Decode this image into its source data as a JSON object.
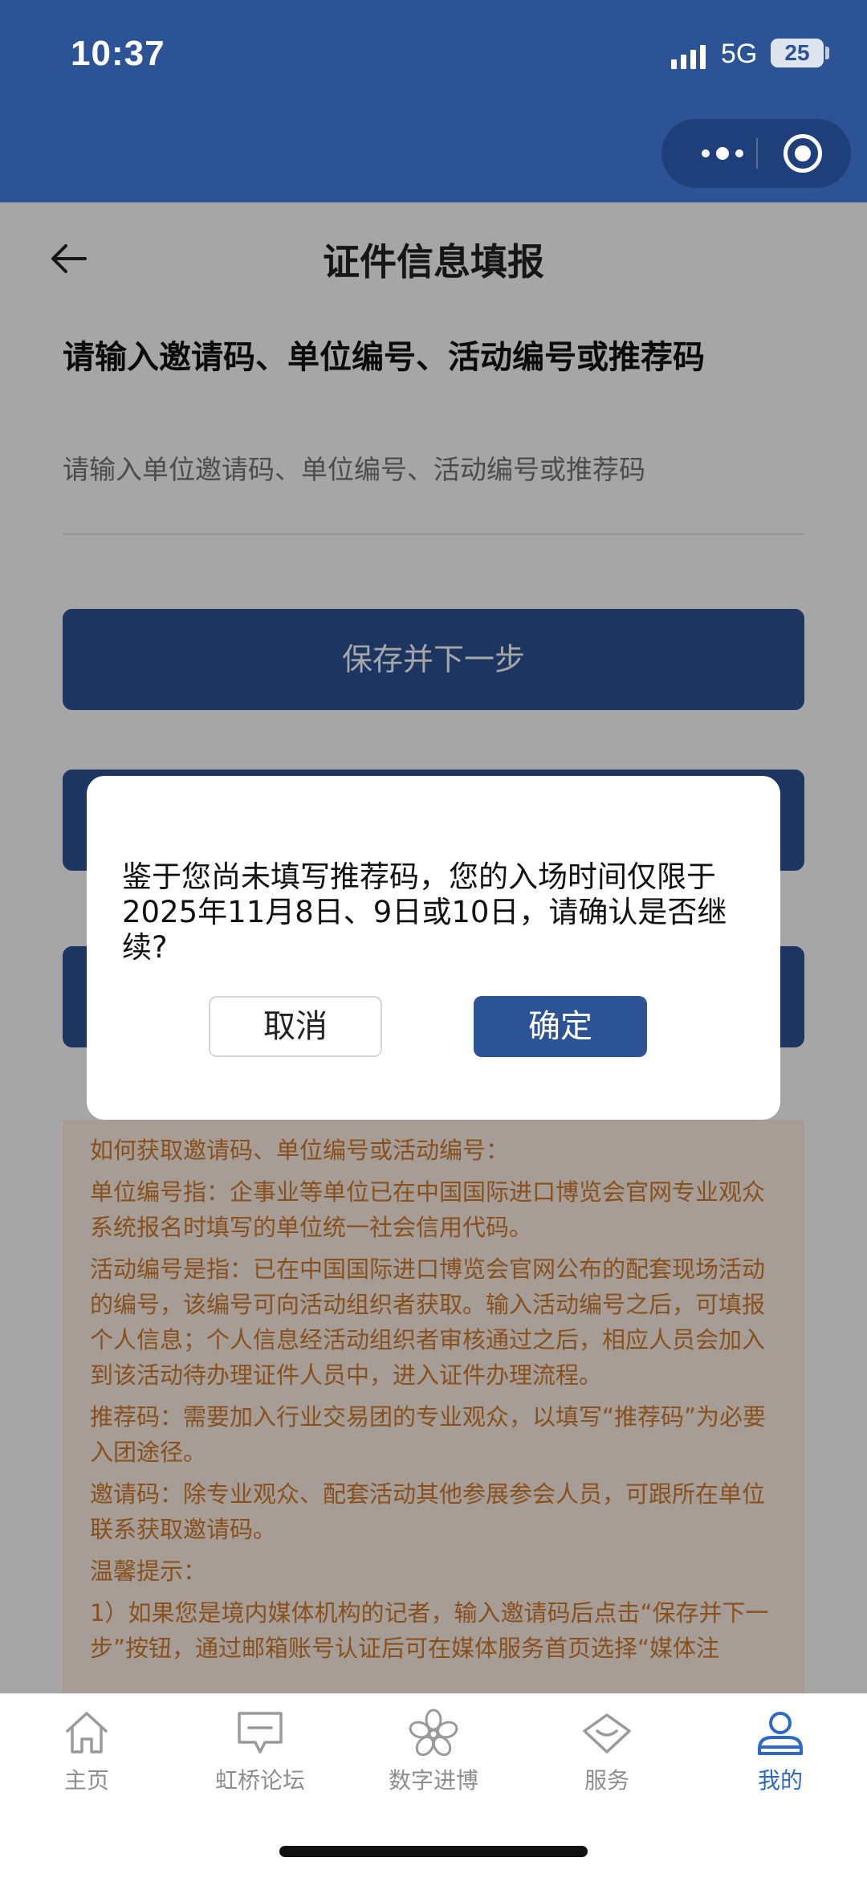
{
  "status_bar": {
    "time": "10:37",
    "network": "5G",
    "battery": "25"
  },
  "header": {
    "title": "证件信息填报"
  },
  "form": {
    "heading": "请输入邀请码、单位编号、活动编号或推荐码",
    "input_placeholder": "请输入单位邀请码、单位编号、活动编号或推荐码",
    "save_next_label": "保存并下一步"
  },
  "info": {
    "lines": [
      "如何获取邀请码、单位编号或活动编号：",
      "单位编号指：企事业等单位已在中国国际进口博览会官网专业观众系统报名时填写的单位统一社会信用代码。",
      "活动编号是指：已在中国国际进口博览会官网公布的配套现场活动的编号，该编号可向活动组织者获取。输入活动编号之后，可填报个人信息；个人信息经活动组织者审核通过之后，相应人员会加入到该活动待办理证件人员中，进入证件办理流程。",
      "推荐码：需要加入行业交易团的专业观众，以填写“推荐码”为必要入团途径。",
      "邀请码：除专业观众、配套活动其他参展参会人员，可跟所在单位联系获取邀请码。",
      "温馨提示：",
      "1）如果您是境内媒体机构的记者，输入邀请码后点击“保存并下一步”按钮，通过邮箱账号认证后可在媒体服务首页选择“媒体注"
    ]
  },
  "dialog": {
    "message": "鉴于您尚未填写推荐码，您的入场时间仅限于2025年11月8日、9日或10日，请确认是否继续?",
    "cancel_label": "取消",
    "confirm_label": "确定"
  },
  "tabbar": {
    "items": [
      {
        "label": "主页",
        "icon": "home-icon",
        "active": false
      },
      {
        "label": "虹桥论坛",
        "icon": "chat-icon",
        "active": false
      },
      {
        "label": "数字进博",
        "icon": "flower-icon",
        "active": false
      },
      {
        "label": "服务",
        "icon": "diamond-icon",
        "active": false
      },
      {
        "label": "我的",
        "icon": "user-icon",
        "active": true
      }
    ]
  },
  "colors": {
    "brand": "#2c5395",
    "active_tab": "#2d6ac7",
    "info_text": "#d37a2b",
    "info_bg": "#fdf2e7"
  }
}
